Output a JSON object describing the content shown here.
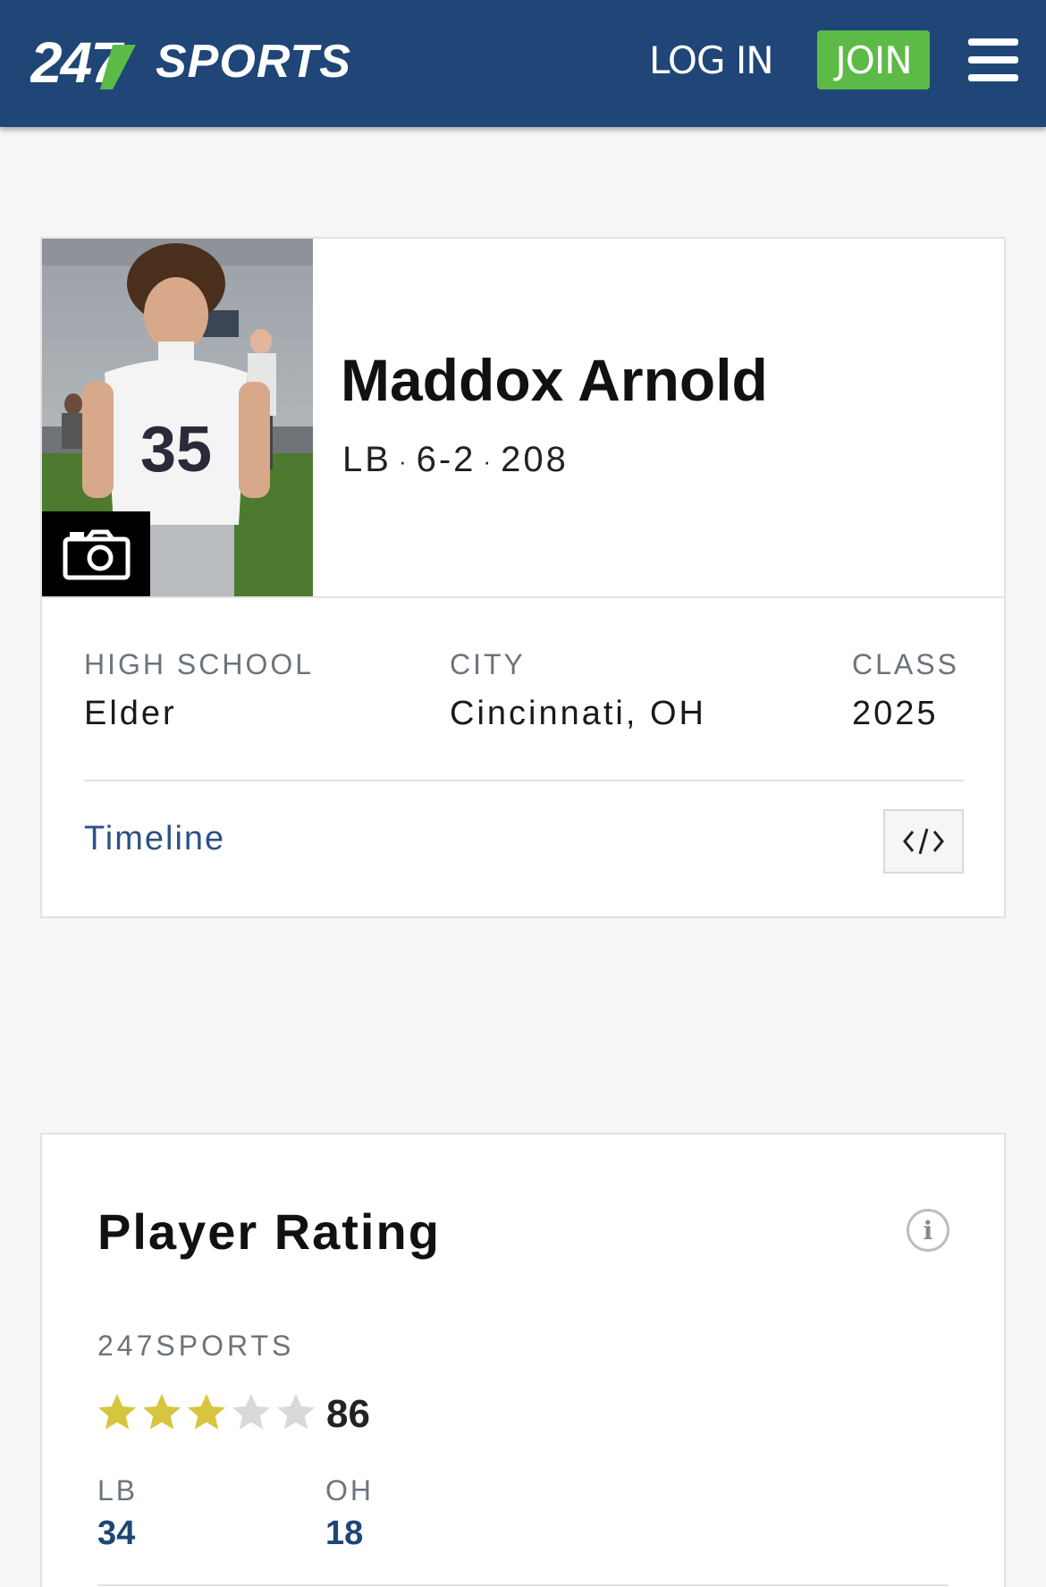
{
  "header": {
    "logo_text_numbers": "247",
    "logo_text_word": "SPORTS",
    "login_label": "LOG IN",
    "join_label": "JOIN",
    "colors": {
      "bar": "#1f4677",
      "join": "#5cba47",
      "logo_green": "#5cba47"
    }
  },
  "player": {
    "name": "Maddox Arnold",
    "position": "LB",
    "height": "6-2",
    "weight": "208",
    "photo_icon": "camera-icon",
    "jersey_number": "35",
    "info": [
      {
        "label": "HIGH SCHOOL",
        "value": "Elder"
      },
      {
        "label": "CITY",
        "value": "Cincinnati, OH"
      },
      {
        "label": "CLASS",
        "value": "2025"
      }
    ],
    "timeline_label": "Timeline",
    "embed_icon": "code-icon"
  },
  "rating": {
    "title": "Player Rating",
    "info_icon_text": "i",
    "source": "247SPORTS",
    "stars_filled": 3,
    "stars_total": 5,
    "score": "86",
    "ranks": [
      {
        "label": "LB",
        "value": "34"
      },
      {
        "label": "OH",
        "value": "18"
      }
    ],
    "star_color": "#d8c53f",
    "star_empty_color": "#d9d9d9"
  }
}
